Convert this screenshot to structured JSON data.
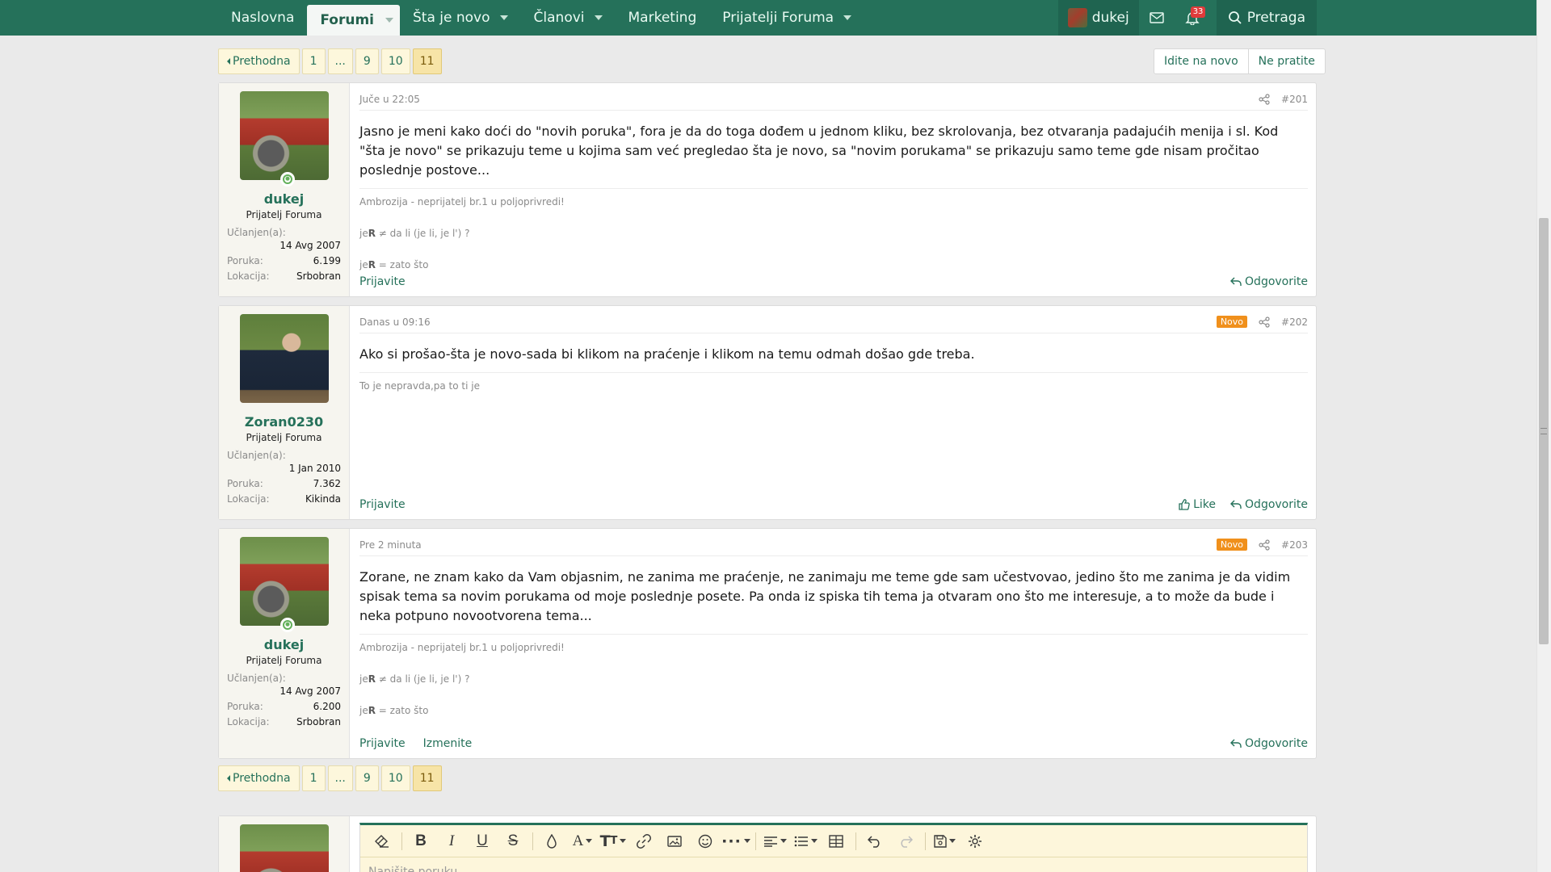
{
  "nav": {
    "items": [
      {
        "label": "Naslovna",
        "active": false,
        "dropdown": false
      },
      {
        "label": "Forumi",
        "active": true,
        "dropdown": true
      },
      {
        "label": "Šta je novo",
        "active": false,
        "dropdown": true
      },
      {
        "label": "Članovi",
        "active": false,
        "dropdown": true
      },
      {
        "label": "Marketing",
        "active": false,
        "dropdown": false
      },
      {
        "label": "Prijatelji Foruma",
        "active": false,
        "dropdown": true
      }
    ],
    "user": "dukej",
    "alerts_count": "33",
    "search_label": "Pretraga"
  },
  "pagination": {
    "prev_label": "Prethodna",
    "pages": [
      "1",
      "...",
      "9",
      "10",
      "11"
    ],
    "current": "11"
  },
  "thread_actions": {
    "unread": "Idite na novo",
    "unwatch": "Ne pratite"
  },
  "posts": [
    {
      "time": "Juče u 22:05",
      "number": "#201",
      "is_new": false,
      "new_label": "",
      "author": "dukej",
      "author_title": "Prijatelj Foruma",
      "joined_label": "Učlanjen(a):",
      "joined": "14 Avg 2007",
      "posts_label": "Poruka:",
      "posts": "6.199",
      "location_label": "Lokacija:",
      "location": "Srbobran",
      "body": "Jasno je meni kako doći do \"novih poruka\", fora je da do toga dođem u jednom kliku, bez skrolovanja, bez otvaranja padajućih menija i sl. Kod \"šta je novo\" se prikazuju teme u kojima sam već pregledao šta je novo, sa \"novim porukama\" se prikazuju samo teme gde nisam pročitao poslednje postove...",
      "signature": [
        "Ambrozija - neprijatelj br.1 u poljoprivredi!",
        "jeR ≠ da li (je li, je l') ?",
        "jeR = zato što"
      ],
      "report_label": "Prijavite",
      "edit_label": "",
      "like_label": "",
      "reply_label": "Odgovorite"
    },
    {
      "time": "Danas u 09:16",
      "number": "#202",
      "is_new": true,
      "new_label": "Novo",
      "author": "Zoran0230",
      "author_title": "Prijatelj Foruma",
      "joined_label": "Učlanjen(a):",
      "joined": "1 Jan 2010",
      "posts_label": "Poruka:",
      "posts": "7.362",
      "location_label": "Lokacija:",
      "location": "Kikinda",
      "body": "Ako si prošao-šta je novo-sada bi klikom na praćenje i klikom na temu odmah došao gde treba.",
      "signature": [
        "To je nepravda,pa to ti je"
      ],
      "report_label": "Prijavite",
      "edit_label": "",
      "like_label": "Like",
      "reply_label": "Odgovorite"
    },
    {
      "time": "Pre 2 minuta",
      "number": "#203",
      "is_new": true,
      "new_label": "Novo",
      "author": "dukej",
      "author_title": "Prijatelj Foruma",
      "joined_label": "Učlanjen(a):",
      "joined": "14 Avg 2007",
      "posts_label": "Poruka:",
      "posts": "6.200",
      "location_label": "Lokacija:",
      "location": "Srbobran",
      "body": "Zorane, ne znam kako da Vam objasnim, ne zanima me praćenje, ne zanimaju me teme gde sam učestvovao, jedino što me zanima je da vidim spisak tema sa novim porukama od moje poslednje posete. Pa onda iz spiska tih tema ja otvaram ono što me interesuje, a to može da bude i neka potpuno novootvorena tema...",
      "signature": [
        "Ambrozija - neprijatelj br.1 u poljoprivredi!",
        "jeR ≠ da li (je li, je l') ?",
        "jeR = zato što"
      ],
      "report_label": "Prijavite",
      "edit_label": "Izmenite",
      "like_label": "",
      "reply_label": "Odgovorite"
    }
  ],
  "editor": {
    "placeholder": "Napišite poruku..."
  },
  "colors": {
    "brand": "#25715a",
    "new_badge": "#f0901c",
    "pager_bg": "#fdf7dc"
  }
}
